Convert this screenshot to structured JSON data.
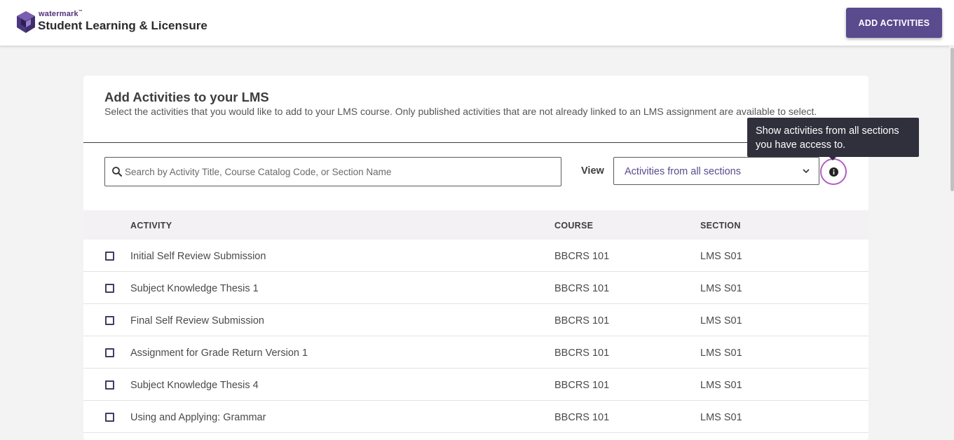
{
  "header": {
    "brand_small": "watermark",
    "brand_tm": "™",
    "brand_title": "Student Learning & Licensure",
    "add_button_label": "ADD ACTIVITIES"
  },
  "panel": {
    "title": "Add Activities to your LMS",
    "description": "Select the activities that you would like to add to your LMS course. Only published activities that are not already linked to an LMS assignment are available to select."
  },
  "search": {
    "placeholder": "Search by Activity Title, Course Catalog Code, or Section Name",
    "value": ""
  },
  "view": {
    "label": "View",
    "selected": "Activities from all sections"
  },
  "tooltip": {
    "text_line1": "Show activities from all sections",
    "text_line2": "you have access to."
  },
  "table": {
    "columns": {
      "activity": "ACTIVITY",
      "course": "COURSE",
      "section": "SECTION"
    },
    "rows": [
      {
        "activity": "Initial Self Review Submission",
        "course": "BBCRS 101",
        "section": "LMS S01"
      },
      {
        "activity": "Subject Knowledge Thesis 1",
        "course": "BBCRS 101",
        "section": "LMS S01"
      },
      {
        "activity": "Final Self Review Submission",
        "course": "BBCRS 101",
        "section": "LMS S01"
      },
      {
        "activity": "Assignment for Grade Return Version 1",
        "course": "BBCRS 101",
        "section": "LMS S01"
      },
      {
        "activity": "Subject Knowledge Thesis 4",
        "course": "BBCRS 101",
        "section": "LMS S01"
      },
      {
        "activity": "Using and Applying: Grammar",
        "course": "BBCRS 101",
        "section": "LMS S01"
      }
    ]
  },
  "colors": {
    "accent": "#5a4a8e",
    "focus_ring": "#b35dc4",
    "tooltip_bg": "#30303d"
  },
  "icons": [
    "watermark-logo-icon",
    "search-icon",
    "chevron-down-icon",
    "info-icon"
  ]
}
